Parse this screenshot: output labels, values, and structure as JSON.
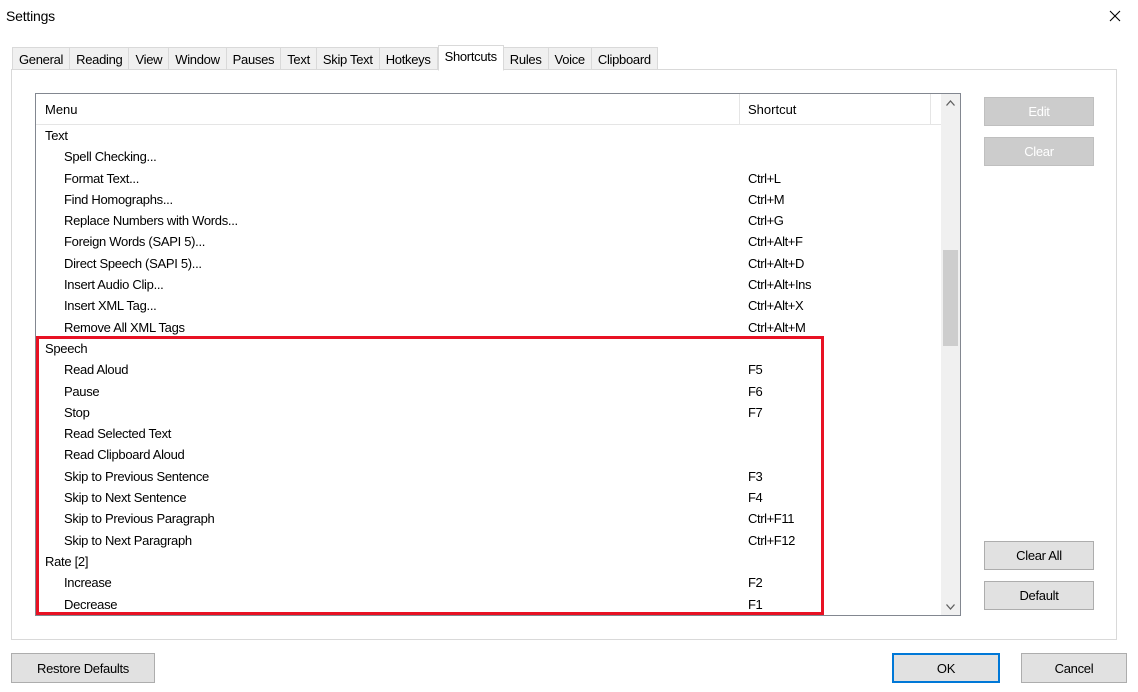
{
  "window": {
    "title": "Settings"
  },
  "tabs": [
    {
      "label": "General"
    },
    {
      "label": "Reading"
    },
    {
      "label": "View"
    },
    {
      "label": "Window"
    },
    {
      "label": "Pauses"
    },
    {
      "label": "Text"
    },
    {
      "label": "Skip Text"
    },
    {
      "label": "Hotkeys"
    },
    {
      "label": "Shortcuts",
      "active": true
    },
    {
      "label": "Rules"
    },
    {
      "label": "Voice"
    },
    {
      "label": "Clipboard"
    }
  ],
  "shortcuts_list": {
    "columns": {
      "menu": "Menu",
      "shortcut": "Shortcut"
    },
    "rows": [
      {
        "type": "group",
        "menu": "Text",
        "shortcut": ""
      },
      {
        "type": "item",
        "menu": "Spell Checking...",
        "shortcut": ""
      },
      {
        "type": "item",
        "menu": "Format Text...",
        "shortcut": "Ctrl+L"
      },
      {
        "type": "item",
        "menu": "Find Homographs...",
        "shortcut": "Ctrl+M"
      },
      {
        "type": "item",
        "menu": "Replace Numbers with Words...",
        "shortcut": "Ctrl+G"
      },
      {
        "type": "item",
        "menu": "Foreign Words (SAPI 5)...",
        "shortcut": "Ctrl+Alt+F"
      },
      {
        "type": "item",
        "menu": "Direct Speech (SAPI 5)...",
        "shortcut": "Ctrl+Alt+D"
      },
      {
        "type": "item",
        "menu": "Insert Audio Clip...",
        "shortcut": "Ctrl+Alt+Ins"
      },
      {
        "type": "item",
        "menu": "Insert XML Tag...",
        "shortcut": "Ctrl+Alt+X"
      },
      {
        "type": "item",
        "menu": "Remove All XML Tags",
        "shortcut": "Ctrl+Alt+M"
      },
      {
        "type": "group",
        "menu": "Speech",
        "shortcut": ""
      },
      {
        "type": "item",
        "menu": "Read Aloud",
        "shortcut": "F5"
      },
      {
        "type": "item",
        "menu": "Pause",
        "shortcut": "F6"
      },
      {
        "type": "item",
        "menu": "Stop",
        "shortcut": "F7"
      },
      {
        "type": "item",
        "menu": "Read Selected Text",
        "shortcut": ""
      },
      {
        "type": "item",
        "menu": "Read Clipboard Aloud",
        "shortcut": ""
      },
      {
        "type": "item",
        "menu": "Skip to Previous Sentence",
        "shortcut": "F3"
      },
      {
        "type": "item",
        "menu": "Skip to Next Sentence",
        "shortcut": "F4"
      },
      {
        "type": "item",
        "menu": "Skip to Previous Paragraph",
        "shortcut": "Ctrl+F11"
      },
      {
        "type": "item",
        "menu": "Skip to Next Paragraph",
        "shortcut": "Ctrl+F12"
      },
      {
        "type": "group",
        "menu": "Rate [2]",
        "shortcut": ""
      },
      {
        "type": "item",
        "menu": "Increase",
        "shortcut": "F2"
      },
      {
        "type": "item",
        "menu": "Decrease",
        "shortcut": "F1"
      }
    ]
  },
  "side_buttons": {
    "edit": "Edit",
    "clear": "Clear",
    "clear_all": "Clear All",
    "default": "Default"
  },
  "footer": {
    "restore_defaults": "Restore Defaults",
    "ok": "OK",
    "cancel": "Cancel"
  },
  "colors": {
    "highlight": "#e81123",
    "accent": "#0078d7"
  }
}
